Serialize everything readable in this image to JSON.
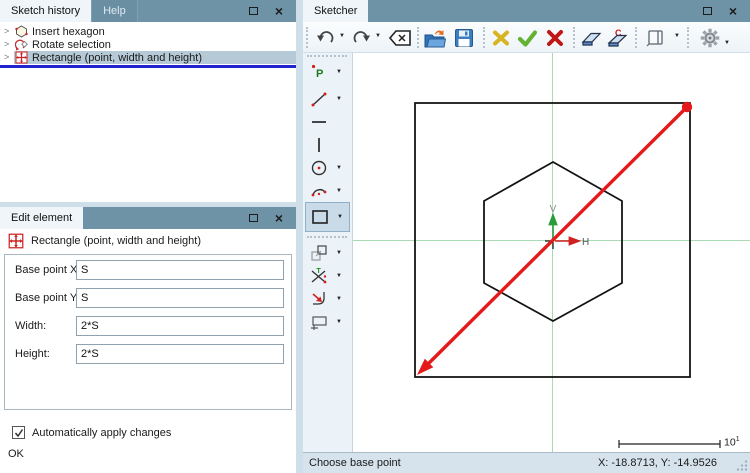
{
  "colors": {
    "titlebar": "#6e93a7",
    "active_tab": "#eff5f8",
    "selection": "#b5c9d6",
    "drop_line": "#2121cd",
    "axis_line": "#a8dab6",
    "v_arrow_green": "#2a9d3a",
    "h_arrow_red": "#d02020",
    "red_marker": "#e41a1a",
    "status_bar": "#d6e3ec"
  },
  "left_top_panel": {
    "tabs": [
      {
        "label": "Sketch history",
        "active": true
      },
      {
        "label": "Help",
        "active": false
      }
    ],
    "items": [
      {
        "icon": "hexagon-icon",
        "label": "Insert hexagon"
      },
      {
        "icon": "rotate-icon",
        "label": "Rotate selection"
      },
      {
        "icon": "rectangle-icon",
        "label": "Rectangle (point, width and height)",
        "selected": true
      }
    ]
  },
  "edit_panel": {
    "title": "Edit element",
    "element_label": "Rectangle (point, width and height)",
    "fields": [
      {
        "label": "Base point X:",
        "value": "S"
      },
      {
        "label": "Base point Y:",
        "value": "S"
      },
      {
        "label": "Width:",
        "value": "2*S"
      },
      {
        "label": "Height:",
        "value": "2*S"
      }
    ],
    "auto_apply": {
      "label": "Automatically apply changes",
      "checked": true
    },
    "ok_label": "OK"
  },
  "sketcher": {
    "tab": "Sketcher",
    "toolbar_icons": [
      "undo",
      "undo-dropdown",
      "redo",
      "redo-dropdown",
      "backspace-delete",
      "open-file",
      "save",
      "discard-cross",
      "apply-check",
      "cancel-cross",
      "eraser",
      "eraser-constraints",
      "panel-toggle",
      "panel-dropdown",
      "settings-gear"
    ],
    "palette_tools": [
      "point",
      "line",
      "horizontal-line",
      "vertical-line",
      "circle",
      "arc",
      "rectangle",
      "offset",
      "trim",
      "corner",
      "dimension"
    ],
    "selected_tool": "rectangle",
    "axis": {
      "v": "V",
      "h": "H"
    },
    "scale": {
      "base": "10",
      "exp": "1"
    },
    "status": {
      "left": "Choose base point",
      "right": "X: -18.8713, Y: -14.9526"
    }
  }
}
